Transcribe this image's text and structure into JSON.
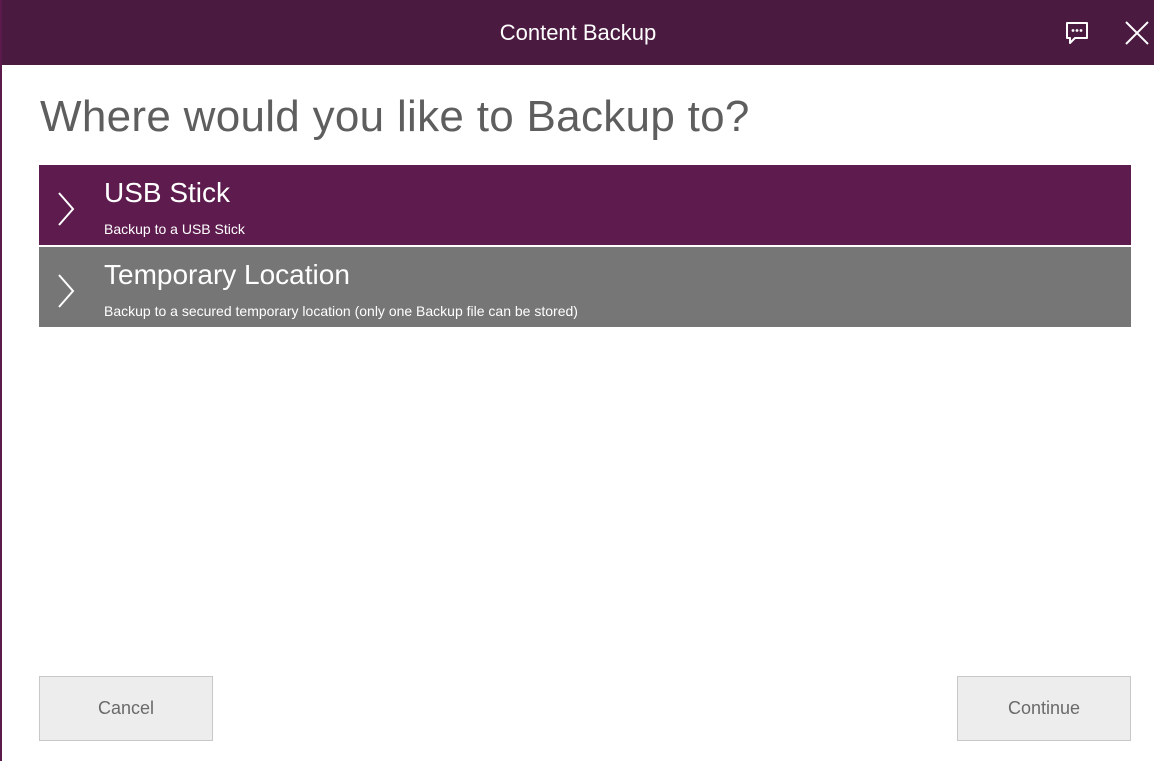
{
  "window": {
    "title": "Content Backup",
    "colors": {
      "titlebar": "#4b1a40",
      "selected_option": "#5e1b4e",
      "unselected_option": "#767676"
    }
  },
  "titlebar_icons": {
    "feedback": "feedback-icon",
    "close": "close-icon"
  },
  "page": {
    "heading": "Where would you like to Backup to?"
  },
  "options": [
    {
      "title": "USB Stick",
      "subtitle": "Backup to a USB Stick",
      "selected": true,
      "color": "#5e1b4e",
      "icon": "chevron-right-icon"
    },
    {
      "title": "Temporary Location",
      "subtitle": "Backup to a secured temporary location (only one Backup file can be stored)",
      "selected": false,
      "color": "#767676",
      "icon": "chevron-right-icon"
    }
  ],
  "footer": {
    "cancel_label": "Cancel",
    "continue_label": "Continue"
  }
}
